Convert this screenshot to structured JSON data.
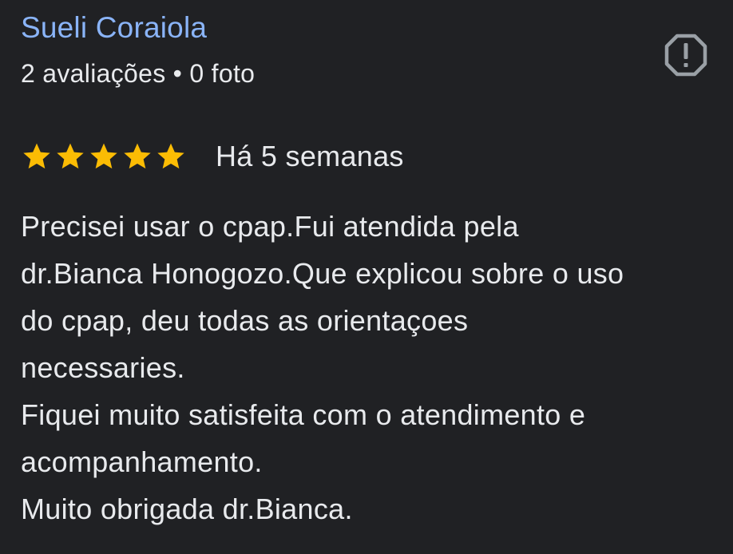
{
  "reviewer": {
    "name": "Sueli Coraiola",
    "meta": "2 avaliações • 0 foto"
  },
  "report": {
    "icon": "report-flag-icon"
  },
  "rating": {
    "stars": 5,
    "max_stars": 5,
    "star_color": "#fbbc04",
    "date": "Há 5 semanas"
  },
  "review": {
    "lines": [
      "Precisei usar o cpap.Fui atendida pela",
      "dr.Bianca Honogozo.Que explicou sobre o uso",
      "do cpap, deu todas as orientaçoes",
      "necessaries.",
      "Fiquei muito satisfeita com o atendimento e",
      "acompanhamento.",
      "Muito obrigada dr.Bianca."
    ]
  },
  "colors": {
    "background": "#202124",
    "name": "#8ab4f8",
    "text": "#e8eaed",
    "icon": "#9aa0a6"
  }
}
